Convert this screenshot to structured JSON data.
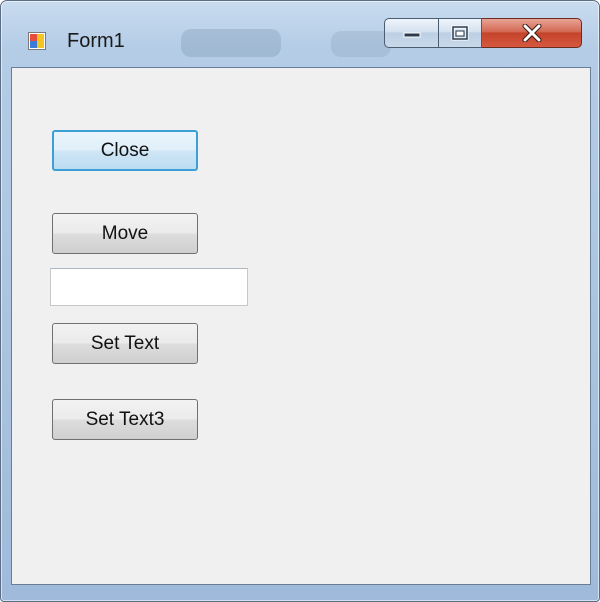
{
  "window": {
    "title": "Form1"
  },
  "caption_buttons": {
    "minimize_icon": "minimize-icon",
    "maximize_icon": "maximize-icon",
    "close_icon": "close-icon"
  },
  "form": {
    "close_label": "Close",
    "move_label": "Move",
    "text_value": "",
    "set_text_label": "Set Text",
    "set_text3_label": "Set Text3"
  },
  "colors": {
    "client_background": "#f0f0f0",
    "close_caption_button": "#c4432b",
    "focus_border": "#3c9fd6"
  }
}
